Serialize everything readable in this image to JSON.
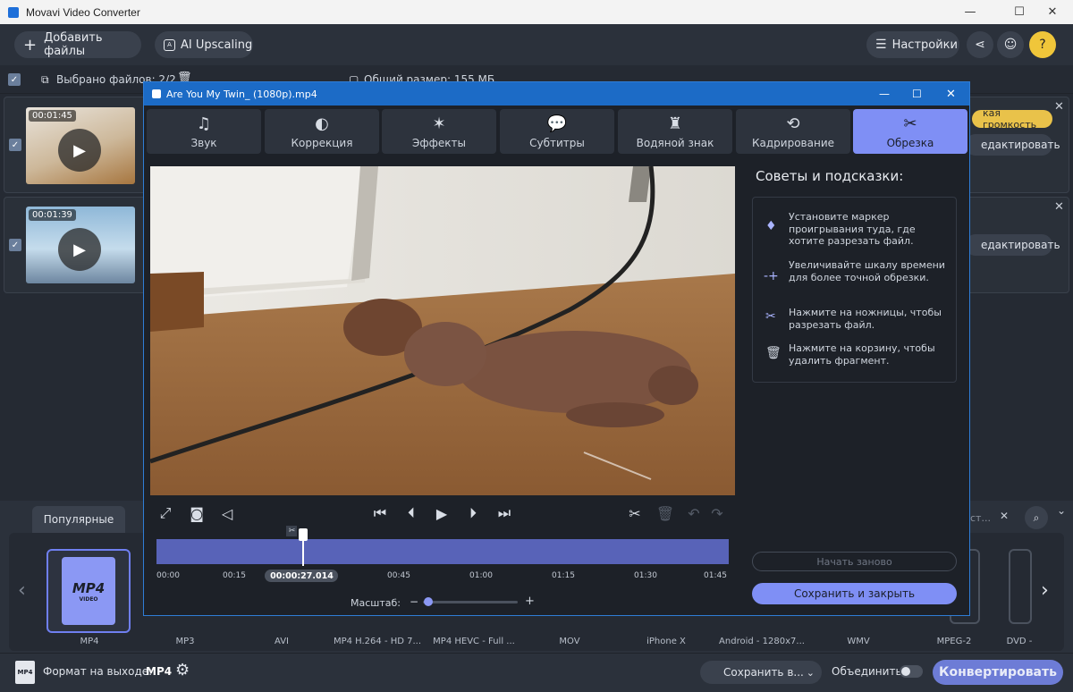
{
  "window": {
    "title": "Movavi Video Converter",
    "minimize": "—",
    "maximize": "☐",
    "close": "✕"
  },
  "toolbar": {
    "add_files": "Добавить файлы",
    "ai_upscaling": "AI Upscaling",
    "settings": "Настройки",
    "help": "?"
  },
  "selection": {
    "selected": "Выбрано файлов: 2/2",
    "total_size": "Общий размер: 155 МБ"
  },
  "files": [
    {
      "duration": "00:01:45",
      "edit": "едактировать",
      "badge": "кая громкость"
    },
    {
      "duration": "00:01:39",
      "edit": "едактировать"
    }
  ],
  "dialog": {
    "title": "Are You My Twin_ (1080p).mp4",
    "tabs": [
      {
        "label": "Звук",
        "icon": "music-note-icon"
      },
      {
        "label": "Коррекция",
        "icon": "contrast-icon"
      },
      {
        "label": "Эффекты",
        "icon": "magic-wand-icon"
      },
      {
        "label": "Субтитры",
        "icon": "speech-bubble-icon"
      },
      {
        "label": "Водяной знак",
        "icon": "stamp-icon"
      },
      {
        "label": "Кадрирование",
        "icon": "crop-rotate-icon"
      },
      {
        "label": "Обрезка",
        "icon": "scissors-icon"
      }
    ],
    "tips_title": "Советы и подсказки:",
    "tips": [
      "Установите маркер проигрывания туда, где хотите разрезать файл.",
      "Увеличивайте шкалу времени для более точной обрезки.",
      "Нажмите на ножницы, чтобы разрезать файл.",
      "Нажмите на корзину, чтобы удалить фрагмент."
    ],
    "timeline_ticks": [
      "00:00",
      "00:15",
      "00:45",
      "01:00",
      "01:15",
      "01:30",
      "01:45"
    ],
    "current_time": "00:00:27.014",
    "playhead_fraction": 0.257,
    "scale_label": "Масштаб:",
    "restart": "Начать заново",
    "save_close": "Сохранить и закрыть"
  },
  "bottom": {
    "tab_popular": "Популярные",
    "search_placeholder": "ст...",
    "formats": [
      "MP4",
      "MP3",
      "AVI",
      "MP4 H.264 - HD 7...",
      "MP4 HEVC - Full ...",
      "MOV",
      "iPhone X",
      "Android - 1280x7...",
      "WMV",
      "MPEG-2",
      "DVD -"
    ],
    "mp4_icon_text": "MP4",
    "mp4_icon_sub": "VIDEO"
  },
  "footer": {
    "output_label": "Формат на выходе:",
    "output_value": "MP4",
    "save_in": "Сохранить в...",
    "merge": "Объединить:",
    "convert": "Конвертировать"
  }
}
